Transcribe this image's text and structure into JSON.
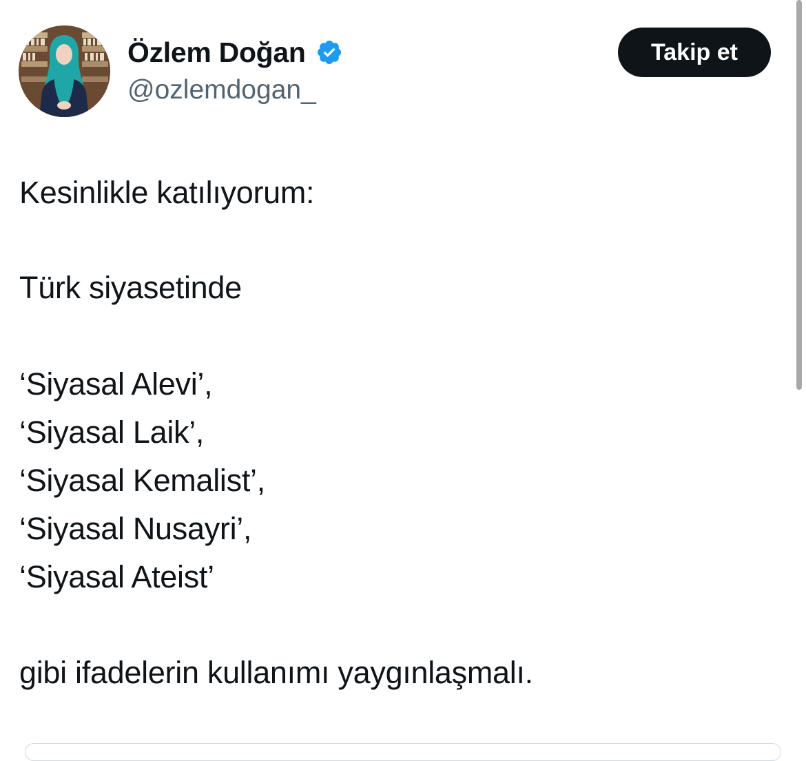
{
  "author": {
    "display_name": "Özlem Doğan",
    "handle": "@ozlemdogan_",
    "verified": true,
    "avatar_icon": "profile-photo"
  },
  "follow_button": {
    "label": "Takip et"
  },
  "tweet": {
    "lines": [
      "Kesinlikle katılıyorum:",
      "",
      "Türk siyasetinde",
      "",
      "‘Siyasal Alevi’,",
      "‘Siyasal Laik’,",
      "‘Siyasal Kemalist’,",
      "‘Siyasal Nusayri’,",
      "‘Siyasal Ateist’",
      "",
      "gibi ifadelerin kullanımı yaygınlaşmalı."
    ]
  },
  "colors": {
    "text": "#0f1419",
    "secondary": "#536471",
    "verified": "#1d9bf0",
    "button_bg": "#0f1419",
    "button_text": "#ffffff"
  }
}
